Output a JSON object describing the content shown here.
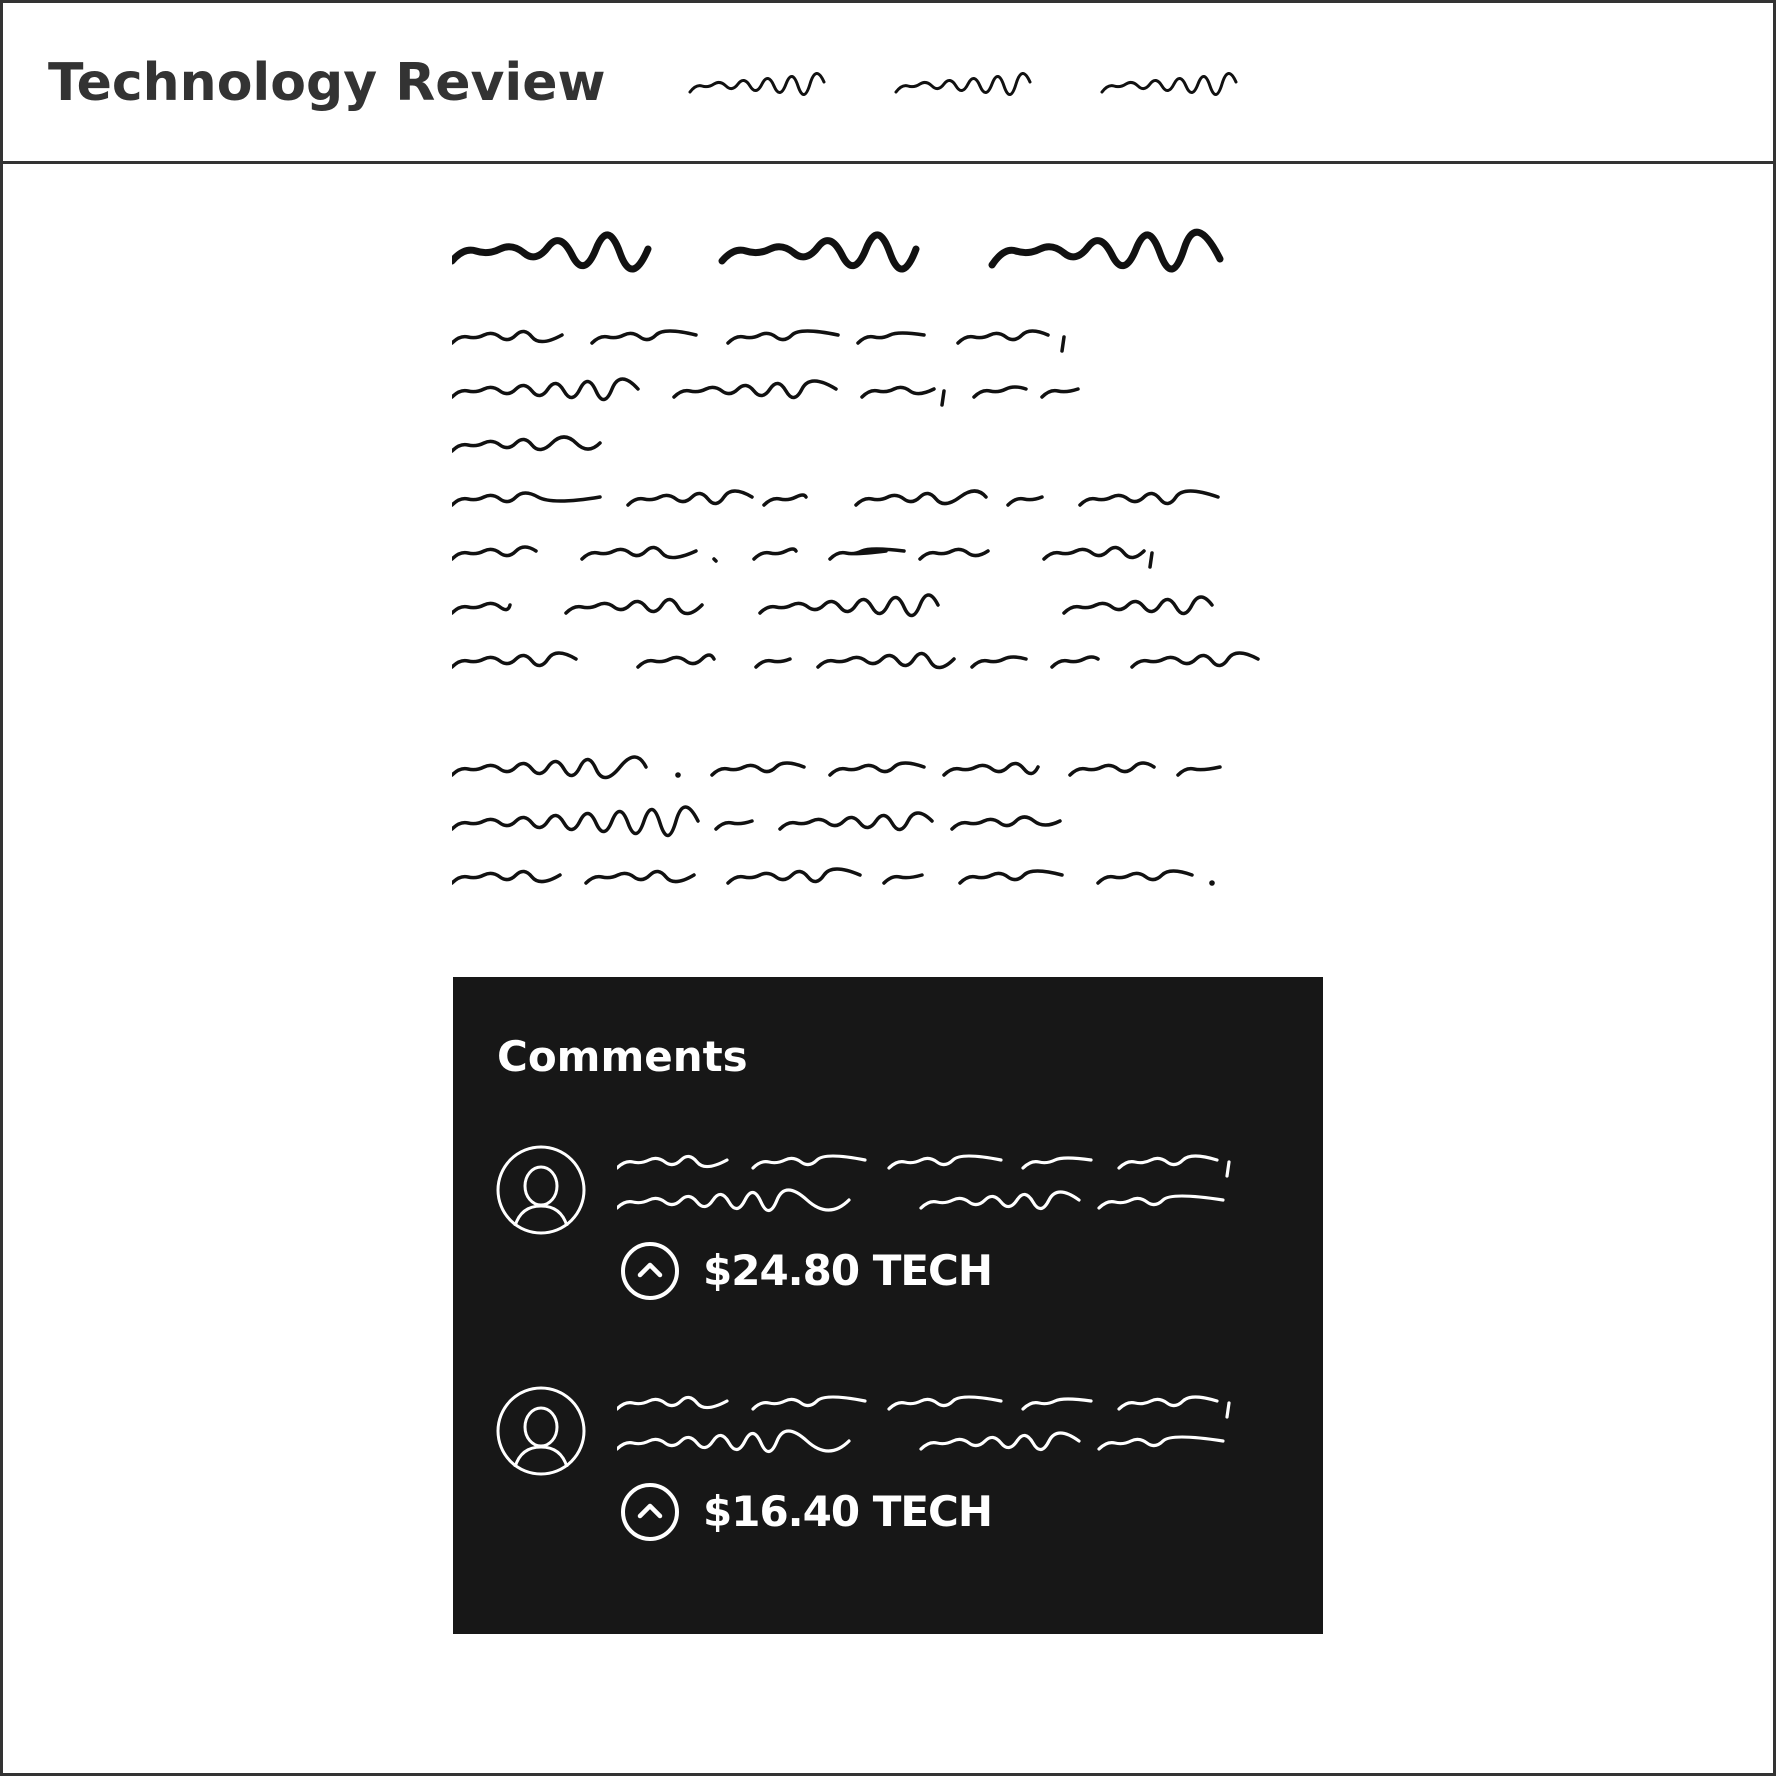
{
  "header": {
    "site_title": "Technology Review",
    "nav_links": [
      "nav-link-1",
      "nav-link-2",
      "nav-link-3"
    ]
  },
  "colors": {
    "ink": "#333333",
    "scribble": "#111111",
    "panel": "#171717",
    "panel_text": "#ffffff"
  },
  "comments": {
    "title": "Comments",
    "items": [
      {
        "amount": "$24.80 TECH",
        "avatar_icon": "user-avatar-icon",
        "vote_icon": "upvote-chevron-icon"
      },
      {
        "amount": "$16.40 TECH",
        "avatar_icon": "user-avatar-icon",
        "vote_icon": "upvote-chevron-icon"
      }
    ]
  }
}
